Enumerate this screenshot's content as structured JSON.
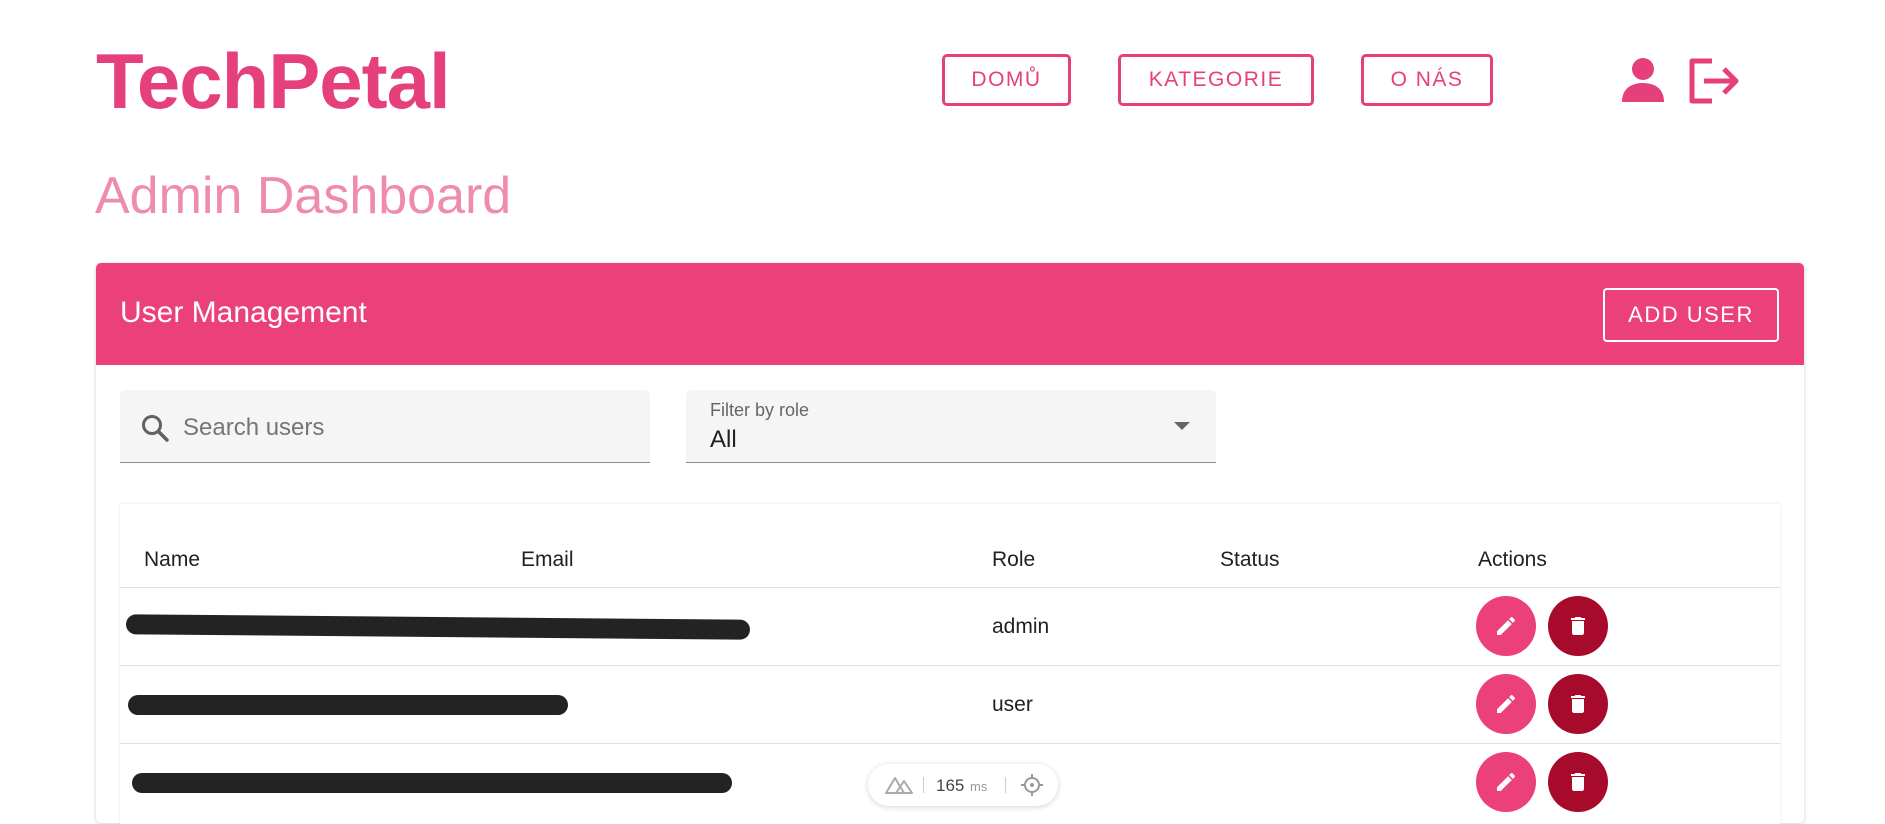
{
  "brand": {
    "name": "TechPetal"
  },
  "nav": {
    "items": [
      {
        "label": "DOMŮ"
      },
      {
        "label": "KATEGORIE"
      },
      {
        "label": "O NÁS"
      }
    ],
    "profile_icon": "user-icon",
    "logout_icon": "logout-icon"
  },
  "page": {
    "title": "Admin Dashboard"
  },
  "card": {
    "title": "User Management",
    "add_user_label": "ADD USER"
  },
  "search": {
    "placeholder": "Search users",
    "icon": "search-icon"
  },
  "filter": {
    "label": "Filter by role",
    "value": "All"
  },
  "table": {
    "columns": [
      "Name",
      "Email",
      "Role",
      "Status",
      "Actions"
    ],
    "rows": [
      {
        "role": "admin",
        "status": ""
      },
      {
        "role": "user",
        "status": ""
      },
      {
        "role": "",
        "status": ""
      }
    ]
  },
  "perf": {
    "value": "165",
    "unit": "ms"
  },
  "colors": {
    "accent": "#eb407a",
    "accent_light": "#f08bb0",
    "danger": "#a80a2c"
  }
}
